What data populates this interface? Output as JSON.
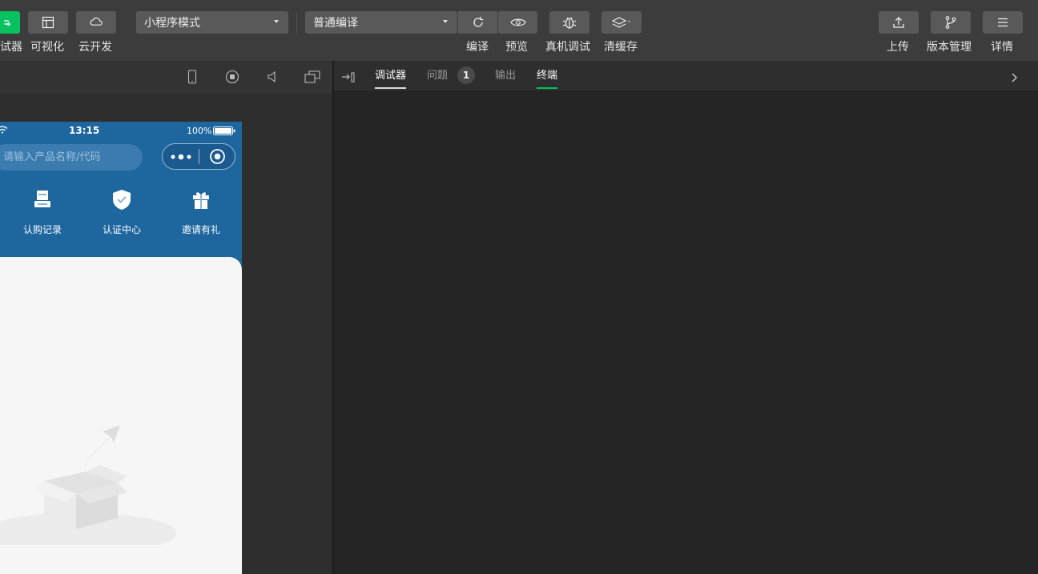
{
  "toolbar": {
    "simulator_label": "试器",
    "visual_label": "可视化",
    "cloud_label": "云开发",
    "mode_select": "小程序模式",
    "compile_select": "普通编译",
    "compile_label": "编译",
    "preview_label": "预览",
    "device_debug_label": "真机调试",
    "clear_cache_label": "清缓存",
    "upload_label": "上传",
    "version_label": "版本管理",
    "details_label": "详情"
  },
  "phone": {
    "time": "13:15",
    "battery": "100%",
    "search_placeholder": "请输入产品名称/代码",
    "quick_items": [
      {
        "label": "认购记录",
        "icon": "document-icon"
      },
      {
        "label": "认证中心",
        "icon": "shield-check-icon"
      },
      {
        "label": "邀请有礼",
        "icon": "gift-icon"
      }
    ]
  },
  "debug": {
    "tabs": [
      {
        "label": "调试器",
        "active": true
      },
      {
        "label": "问题",
        "badge": "1"
      },
      {
        "label": "输出"
      },
      {
        "label": "终端",
        "active": true
      }
    ]
  },
  "colors": {
    "accent_green": "#07c160",
    "phone_blue": "#1e669e"
  }
}
